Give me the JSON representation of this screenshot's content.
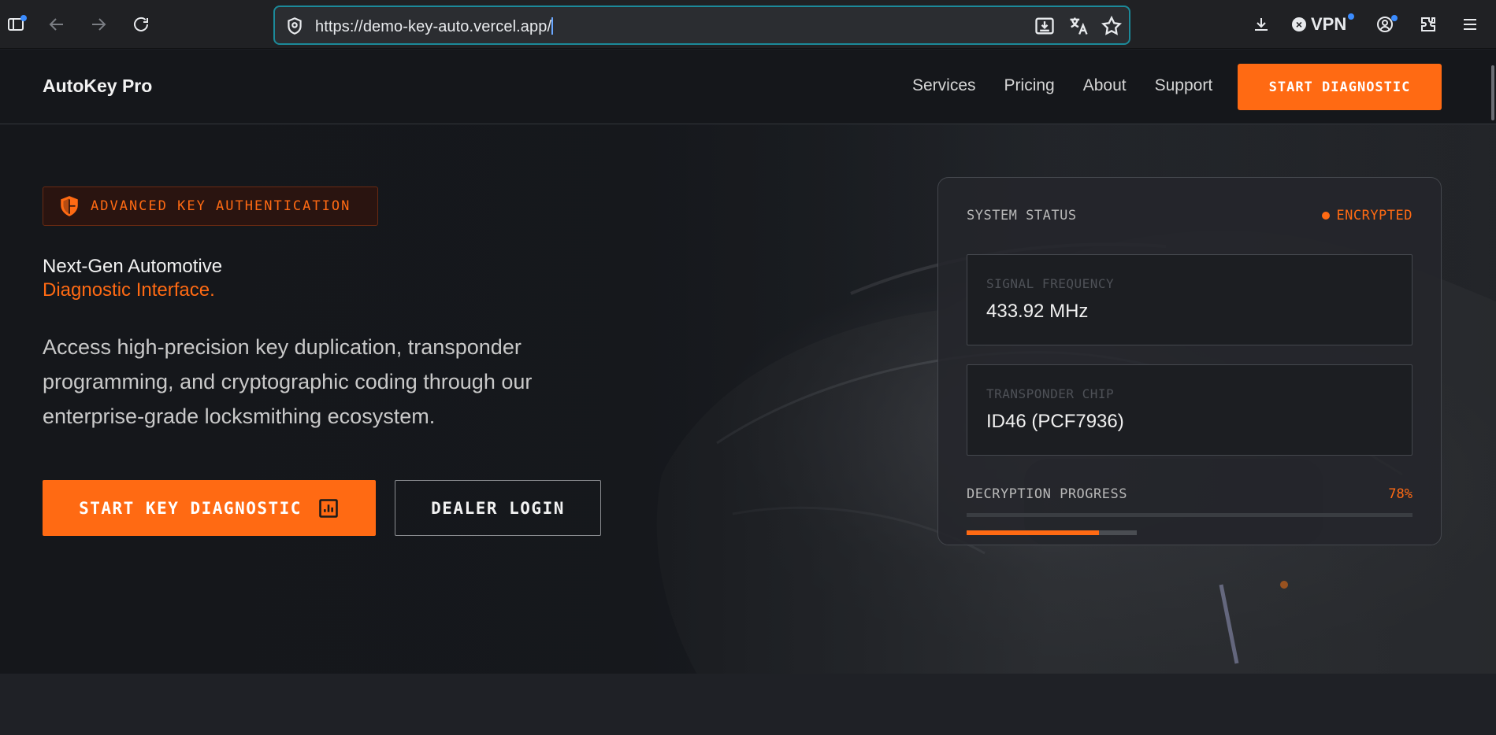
{
  "browser": {
    "url": "https://demo-key-auto.vercel.app/",
    "vpn_label": "VPN",
    "icons": [
      "sidebar-icon",
      "back-icon",
      "forward-icon",
      "reload-icon",
      "shield-icon",
      "install-icon",
      "translate-icon",
      "star-icon",
      "download-icon",
      "vpn-icon",
      "account-icon",
      "extensions-icon",
      "menu-icon"
    ]
  },
  "nav": {
    "brand": "AutoKey Pro",
    "links": [
      "Services",
      "Pricing",
      "About",
      "Support"
    ],
    "cta": "START DIAGNOSTIC"
  },
  "hero": {
    "badge": "ADVANCED KEY AUTHENTICATION",
    "headline": "Next-Gen Automotive",
    "headline_accent": "Diagnostic Interface.",
    "lead": "Access high-precision key duplication, transponder programming, and cryptographic coding through our enterprise-grade locksmithing ecosystem.",
    "primary_button": "START KEY DIAGNOSTIC",
    "secondary_button": "DEALER LOGIN"
  },
  "status_card": {
    "title": "SYSTEM STATUS",
    "state": "ENCRYPTED",
    "signal_label": "SIGNAL FREQUENCY",
    "signal_value": "433.92 MHz",
    "chip_label": "TRANSPONDER CHIP",
    "chip_value": "ID46 (PCF7936)",
    "progress_label": "DECRYPTION PROGRESS",
    "progress_text": "78%",
    "progress_fraction": 0.78
  },
  "colors": {
    "accent": "#ff6a13",
    "background": "#15171b",
    "url_focus": "#1c8a9a"
  }
}
